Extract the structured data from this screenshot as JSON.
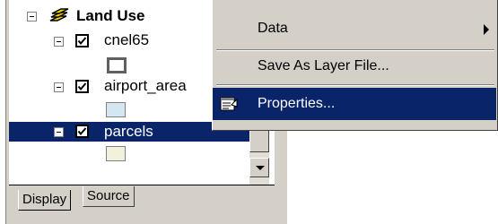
{
  "toc": {
    "group_label": "Land Use",
    "layers": [
      {
        "label": "cnel65",
        "checked": true,
        "swatch_fill": "#ffffff",
        "swatch_border": "#606060"
      },
      {
        "label": "airport_area",
        "checked": true,
        "swatch_fill": "#d4e6ef",
        "swatch_border": "#808080"
      },
      {
        "label": "parcels",
        "checked": true,
        "selected": true,
        "swatch_fill": "#f3f0dd",
        "swatch_border": "#808080"
      }
    ],
    "tabs": [
      "Display",
      "Source"
    ],
    "active_tab": "Display",
    "group_icon": "layers-icon"
  },
  "context_menu": {
    "items": [
      {
        "label": "Data",
        "has_submenu": true
      },
      {
        "label": "Save As Layer File..."
      },
      {
        "label": "Properties...",
        "highlighted": true,
        "icon": "properties-icon"
      }
    ]
  },
  "colors": {
    "selection": "#0a246a",
    "panel": "#d4d0c8",
    "group_icon": "#f0d000"
  }
}
